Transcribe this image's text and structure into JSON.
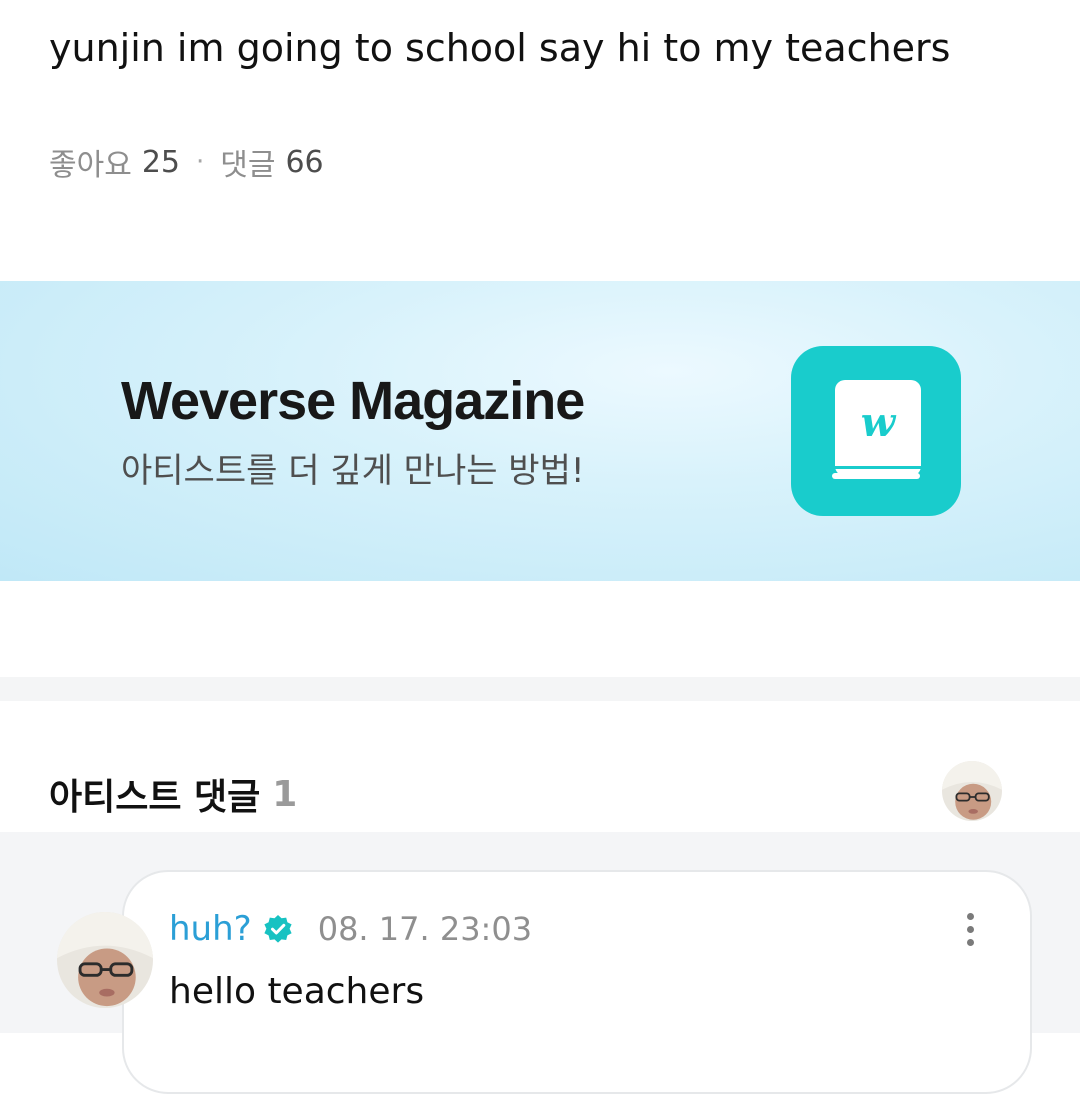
{
  "post": {
    "text": "yunjin im going to school say hi to my teachers",
    "likes_label": "좋아요",
    "likes_count": "25",
    "separator": "·",
    "comments_label": "댓글",
    "comments_count": "66"
  },
  "banner": {
    "title": "Weverse Magazine",
    "subtitle": "아티스트를 더 깊게 만나는 방법!",
    "logo_icon": "weverse-magazine-book-icon",
    "logo_letter": "w",
    "logo_color": "#19cccc"
  },
  "artist_comments": {
    "title": "아티스트 댓글",
    "count": "1",
    "header_avatar_icon": "artist-avatar-icon"
  },
  "comment": {
    "author": "huh?",
    "verified_icon": "verified-badge-icon",
    "time": "08. 17. 23:03",
    "body": "hello teachers",
    "more_icon": "more-vertical-icon",
    "author_color": "#2b9fd6"
  }
}
